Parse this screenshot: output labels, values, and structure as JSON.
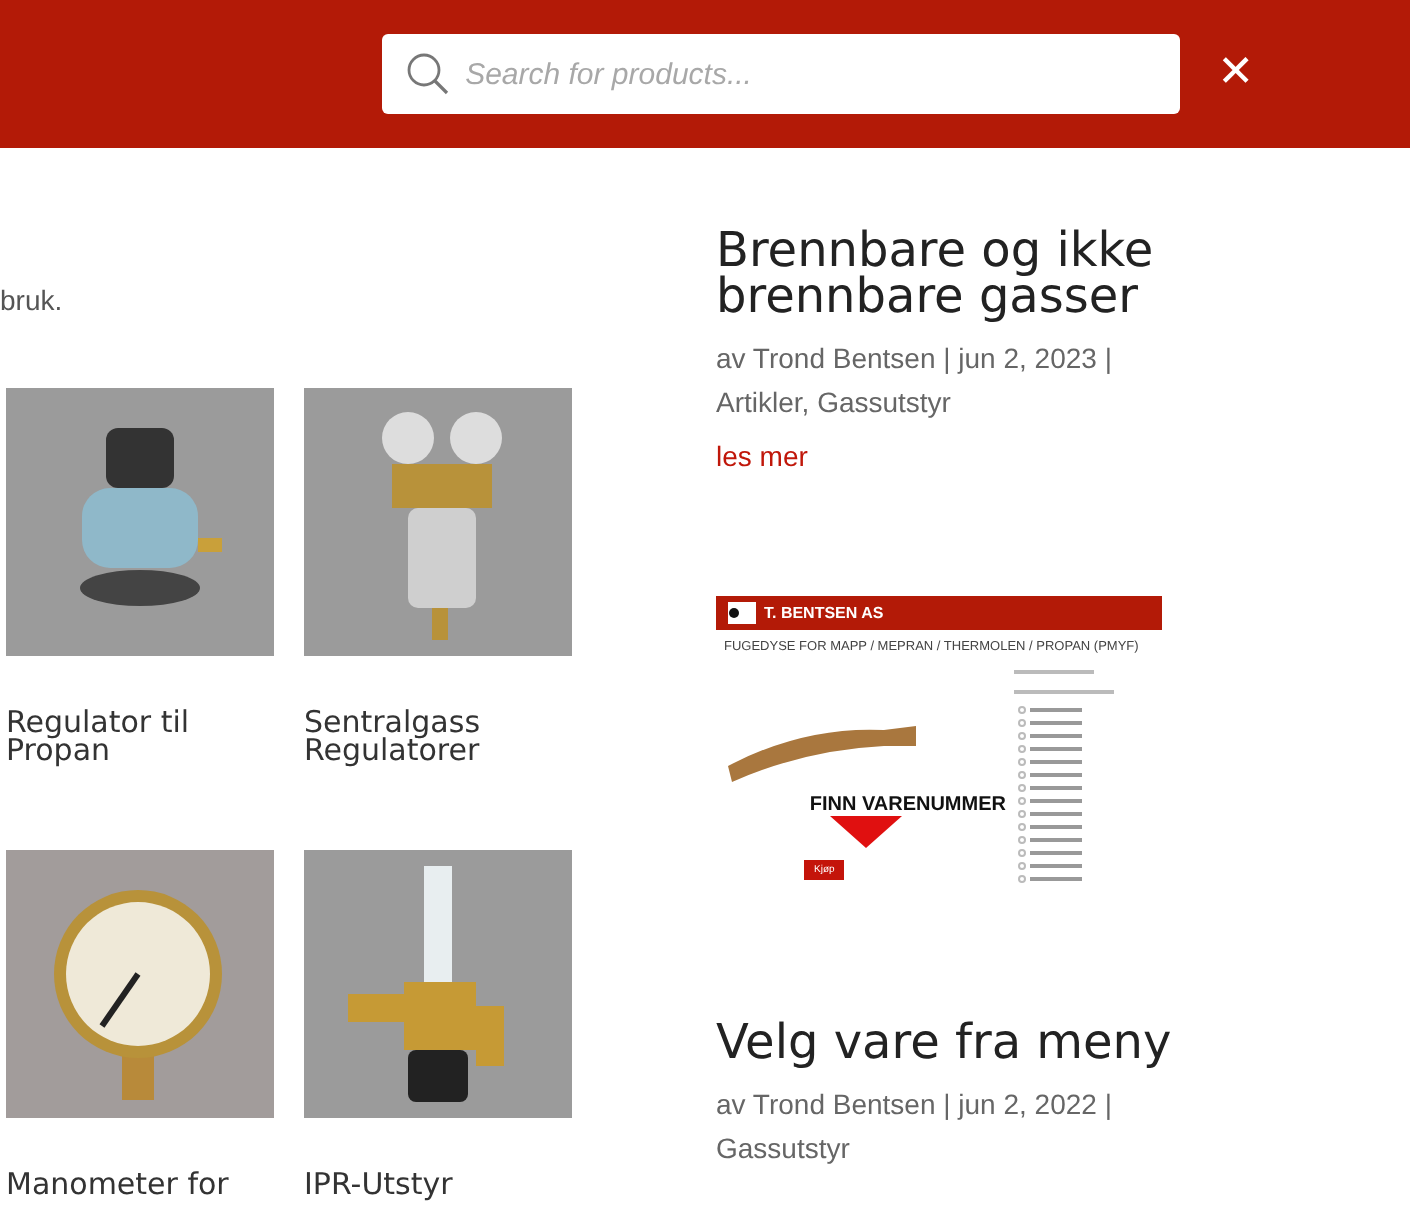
{
  "header": {
    "search": {
      "placeholder": "Search for products..."
    },
    "close_label": "✕"
  },
  "intro_fragment": "bruk.",
  "products": [
    {
      "name": "Regulator til Propan",
      "kind": "regulator"
    },
    {
      "name": "Sentralgass Regulatorer",
      "kind": "filter"
    },
    {
      "name": "Manometer for",
      "kind": "gauge"
    },
    {
      "name": "IPR-Utstyr",
      "kind": "flowmeter"
    }
  ],
  "posts": [
    {
      "title": "Brennbare og ikke brennbare gasser",
      "meta": "av Trond Bentsen | jun 2, 2023 | Artikler, Gassutstyr",
      "read_more": "les mer"
    },
    {
      "title": "Velg vare fra meny",
      "meta": "av Trond Bentsen | jun 2, 2022 | Gassutstyr",
      "featured": {
        "brand": "T. BENTSEN AS",
        "heading": "FUGEDYSE FOR MAPP / MEPRAN / THERMOLEN / PROPAN (PMYF)",
        "callout": "FINN VARENUMMER",
        "buy": "Kjøp"
      }
    }
  ]
}
